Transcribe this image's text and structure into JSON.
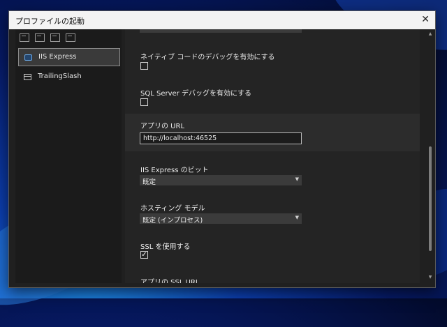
{
  "dialog": {
    "title": "プロファイルの起動",
    "close_label": "✕"
  },
  "sidebar": {
    "toolbar_icons": [
      "new-profile-icon",
      "copy-profile-icon",
      "delete-profile-icon",
      "rename-profile-icon"
    ],
    "profiles": [
      {
        "label": "IIS Express",
        "icon": "iis-globe-icon",
        "selected": true
      },
      {
        "label": "TrailingSlash",
        "icon": "window-icon",
        "selected": false
      }
    ]
  },
  "settings": {
    "native_debug_label": "ネイティブ コードのデバッグを有効にする",
    "native_debug_checked": false,
    "sql_debug_label": "SQL Server デバッグを有効にする",
    "sql_debug_checked": false,
    "app_url_label": "アプリの URL",
    "app_url_value": "http://localhost:46525",
    "iis_bitness_label": "IIS Express のビット",
    "iis_bitness_value": "既定",
    "hosting_model_label": "ホスティング モデル",
    "hosting_model_value": "既定 (インプロセス)",
    "ssl_label": "SSL を使用する",
    "ssl_checked": true,
    "ssl_check_glyph": "✓",
    "ssl_url_label": "アプリの SSL URL"
  },
  "scrollbar": {
    "up_glyph": "▲",
    "down_glyph": "▼"
  },
  "colors": {
    "dialog_bg": "#202020",
    "titlebar_bg": "#f3f3f3",
    "selected_bg": "#3a3a3a",
    "desktop_blue": "#0c3fb0"
  }
}
